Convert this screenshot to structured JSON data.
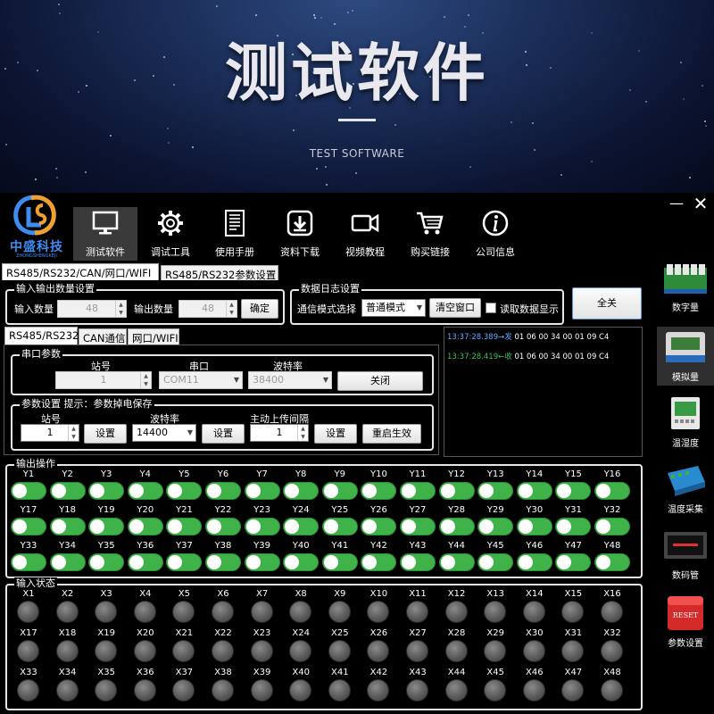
{
  "hero": {
    "title": "测试软件",
    "subtitle": "TEST SOFTWARE"
  },
  "app": {
    "logo": {
      "text": "中盛科技",
      "sub": "ZHONGSHENGKEJI"
    },
    "window_controls": {
      "minimize": "—",
      "close": "✕"
    },
    "nav": [
      {
        "label": "测试软件",
        "icon": "monitor-icon",
        "active": true
      },
      {
        "label": "调试工具",
        "icon": "gear-icon"
      },
      {
        "label": "使用手册",
        "icon": "document-icon"
      },
      {
        "label": "资料下载",
        "icon": "download-icon"
      },
      {
        "label": "视频教程",
        "icon": "video-camera-icon"
      },
      {
        "label": "购买链接",
        "icon": "shopping-cart-icon"
      },
      {
        "label": "公司信息",
        "icon": "info-icon"
      }
    ],
    "main_tabs": [
      {
        "label": "RS485/RS232/CAN/网口/WIFI",
        "selected": true
      },
      {
        "label": "RS485/RS232参数设置",
        "selected": false
      }
    ],
    "io_count": {
      "title": "输入输出数量设置",
      "input_label": "输入数量",
      "input_value": "48",
      "output_label": "输出数量",
      "output_value": "48",
      "confirm": "确定"
    },
    "log_settings": {
      "title": "数据日志设置",
      "mode_label": "通信模式选择",
      "mode_value": "普通模式",
      "clear": "清空窗口",
      "read_display": "读取数据显示"
    },
    "all_off": "全关",
    "sub_tabs": [
      {
        "label": "RS485/RS232",
        "selected": true
      },
      {
        "label": "CAN通信",
        "selected": false
      },
      {
        "label": "网口/WIFI",
        "selected": false
      }
    ],
    "serial": {
      "title": "串口参数",
      "station_label": "站号",
      "port_label": "串口",
      "baud_label": "波特率",
      "station_value": "1",
      "port_value": "COM11",
      "baud_value": "38400",
      "close": "关闭"
    },
    "params": {
      "title": "参数设置 提示：参数掉电保存",
      "station_label": "站号",
      "baud_label": "波特率",
      "interval_label": "主动上传间隔",
      "station_value": "1",
      "baud_value": "14400",
      "interval_value": "1",
      "set": "设置",
      "restart": "重启生效"
    },
    "log": [
      {
        "ts": "13:37:28.389",
        "dir": "→发",
        "data": "01 06 00 34 00 01 09 C4",
        "kind": "send"
      },
      {
        "ts": "13:37:28.419",
        "dir": "←收",
        "data": "01 06 00 34 00 01 09 C4",
        "kind": "recv"
      }
    ],
    "outputs": {
      "title": "输出操作",
      "labels": [
        "Y1",
        "Y2",
        "Y3",
        "Y4",
        "Y5",
        "Y6",
        "Y7",
        "Y8",
        "Y9",
        "Y10",
        "Y11",
        "Y12",
        "Y13",
        "Y14",
        "Y15",
        "Y16",
        "Y17",
        "Y18",
        "Y19",
        "Y20",
        "Y21",
        "Y22",
        "Y23",
        "Y24",
        "Y25",
        "Y26",
        "Y27",
        "Y28",
        "Y29",
        "Y30",
        "Y31",
        "Y32",
        "Y33",
        "Y34",
        "Y35",
        "Y36",
        "Y37",
        "Y38",
        "Y39",
        "Y40",
        "Y41",
        "Y42",
        "Y43",
        "Y44",
        "Y45",
        "Y46",
        "Y47",
        "Y48"
      ],
      "on_color": "#3fb34a"
    },
    "inputs": {
      "title": "输入状态",
      "labels": [
        "X1",
        "X2",
        "X3",
        "X4",
        "X5",
        "X6",
        "X7",
        "X8",
        "X9",
        "X10",
        "X11",
        "X12",
        "X13",
        "X14",
        "X15",
        "X16",
        "X17",
        "X18",
        "X19",
        "X20",
        "X21",
        "X22",
        "X23",
        "X24",
        "X25",
        "X26",
        "X27",
        "X28",
        "X29",
        "X30",
        "X31",
        "X32",
        "X33",
        "X34",
        "X35",
        "X36",
        "X37",
        "X38",
        "X39",
        "X40",
        "X41",
        "X42",
        "X43",
        "X44",
        "X45",
        "X46",
        "X47",
        "X48"
      ],
      "off_color": "#5a5a5a"
    },
    "sidebar": [
      {
        "label": "数字量",
        "icon": "relay-module-icon"
      },
      {
        "label": "模拟量",
        "icon": "analog-module-icon",
        "active": true
      },
      {
        "label": "温湿度",
        "icon": "humidity-sensor-icon"
      },
      {
        "label": "温度采集",
        "icon": "temperature-module-icon"
      },
      {
        "label": "数码管",
        "icon": "led-display-icon"
      },
      {
        "label": "参数设置",
        "icon": "reset-button-icon",
        "badge": "RESET"
      }
    ]
  }
}
